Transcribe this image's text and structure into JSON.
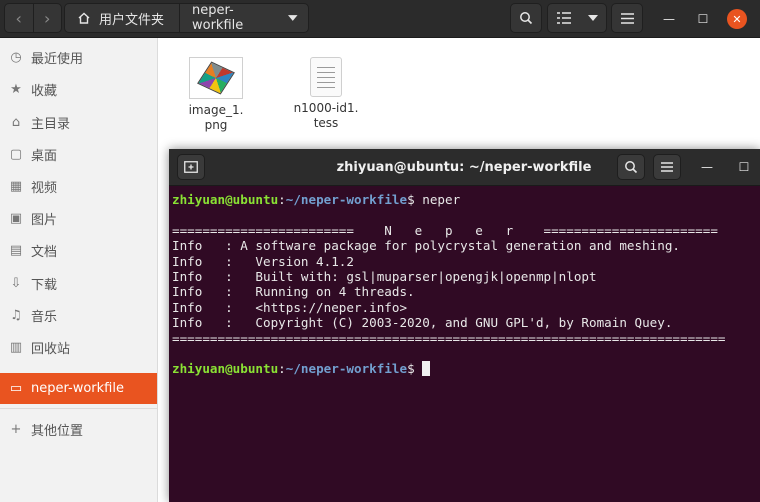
{
  "files_window": {
    "path": {
      "home": "用户文件夹",
      "current": "neper-workfile"
    },
    "sidebar": [
      {
        "label": "最近使用",
        "icon": "clock-icon",
        "active": false
      },
      {
        "label": "收藏",
        "icon": "star-icon",
        "active": false
      },
      {
        "label": "主目录",
        "icon": "home-icon",
        "active": false
      },
      {
        "label": "桌面",
        "icon": "desktop-icon",
        "active": false
      },
      {
        "label": "视频",
        "icon": "video-icon",
        "active": false
      },
      {
        "label": "图片",
        "icon": "picture-icon",
        "active": false
      },
      {
        "label": "文档",
        "icon": "document-icon",
        "active": false
      },
      {
        "label": "下载",
        "icon": "download-icon",
        "active": false
      },
      {
        "label": "音乐",
        "icon": "music-icon",
        "active": false
      },
      {
        "label": "回收站",
        "icon": "trash-icon",
        "active": false
      },
      {
        "label": "neper-workfile",
        "icon": "folder-icon",
        "active": true
      },
      {
        "label": "其他位置",
        "icon": "plus-icon",
        "active": false
      }
    ],
    "files": [
      {
        "name_line1": "image_1.",
        "name_line2": "png",
        "type": "image"
      },
      {
        "name_line1": "n1000-id1.",
        "name_line2": "tess",
        "type": "text"
      }
    ]
  },
  "terminal": {
    "title": "zhiyuan@ubuntu: ~/neper-workfile",
    "prompt_user": "zhiyuan@ubuntu",
    "prompt_sep": ":",
    "prompt_path": "~/neper-workfile",
    "prompt_end": "$ ",
    "command": "neper",
    "output": [
      "========================    N   e   p   e   r    =======================",
      "Info   : A software package for polycrystal generation and meshing.",
      "Info   :   Version 4.1.2",
      "Info   :   Built with: gsl|muparser|opengjk|openmp|nlopt",
      "Info   :   Running on 4 threads.",
      "Info   :   <https://neper.info>",
      "Info   :   Copyright (C) 2003-2020, and GNU GPL'd, by Romain Quey.",
      "========================================================================="
    ]
  },
  "colors": {
    "accent": "#e95420",
    "terminal_bg": "#300a24",
    "prompt_user": "#8ae234",
    "prompt_path": "#729fcf"
  }
}
